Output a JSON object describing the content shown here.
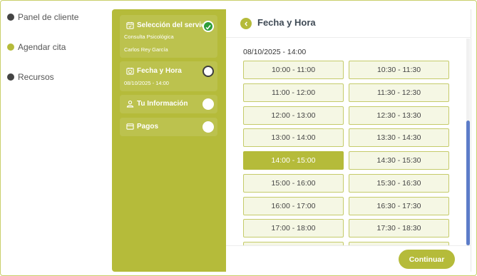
{
  "colors": {
    "accent": "#b5bb3a",
    "done": "#2e9e3a",
    "dark_dot": "#444444"
  },
  "leftnav": {
    "items": [
      {
        "label": "Panel de cliente",
        "dot_color": "#444444"
      },
      {
        "label": "Agendar cita",
        "dot_color": "#b5bb3a"
      },
      {
        "label": "Recursos",
        "dot_color": "#444444"
      }
    ]
  },
  "wizard": {
    "steps": [
      {
        "title": "Selección del servicio",
        "icon": "calendar-check-icon",
        "sub1": "Consulta Psicológica",
        "sub2": "Carlos Rey García",
        "status": "done"
      },
      {
        "title": "Fecha y Hora",
        "icon": "calendar-clock-icon",
        "sub1": "08/10/2025 - 14:00",
        "status": "active"
      },
      {
        "title": "Tu Información",
        "icon": "user-icon",
        "status": "pending"
      },
      {
        "title": "Pagos",
        "icon": "credit-card-icon",
        "status": "pending"
      }
    ]
  },
  "main": {
    "title": "Fecha y Hora",
    "date_label": "08/10/2025 - 14:00",
    "slots_left": [
      "10:00 - 11:00",
      "11:00 - 12:00",
      "12:00 - 13:00",
      "13:00 - 14:00",
      "14:00 - 15:00",
      "15:00 - 16:00",
      "16:00 - 17:00",
      "17:00 - 18:00"
    ],
    "slots_right": [
      "10:30 - 11:30",
      "11:30 - 12:30",
      "12:30 - 13:30",
      "13:30 - 14:30",
      "14:30 - 15:30",
      "15:30 - 16:30",
      "16:30 - 17:30",
      "17:30 - 18:30"
    ],
    "selected_slot": "14:00 - 15:00",
    "continue_label": "Continuar"
  }
}
